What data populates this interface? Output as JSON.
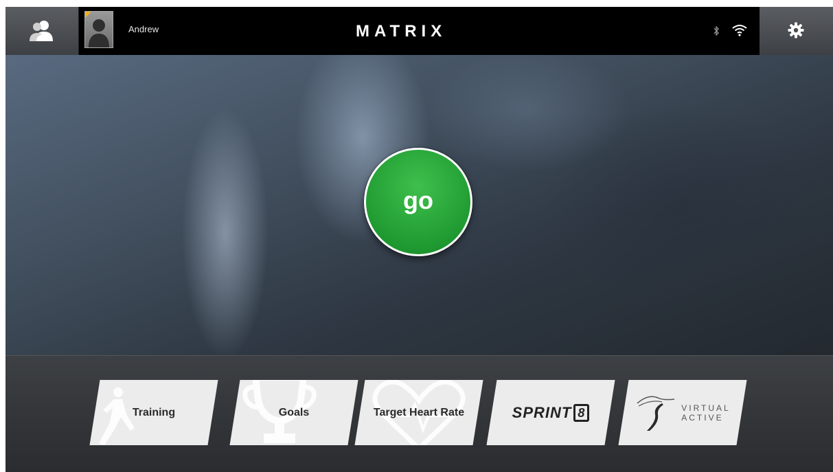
{
  "topbar": {
    "username": "Andrew",
    "logo": "MATRIX",
    "icons": {
      "users": "users-icon",
      "bluetooth": "bluetooth-icon",
      "wifi": "wifi-icon",
      "settings": "gear-icon"
    }
  },
  "hero": {
    "go_label": "go",
    "go_color": "#23a336"
  },
  "menu": {
    "tiles": [
      {
        "label": "Training",
        "icon": "runner-icon"
      },
      {
        "label": "Goals",
        "icon": "trophy-icon"
      },
      {
        "label": "Target Heart Rate",
        "icon": "heart-icon"
      },
      {
        "label": "SPRINT",
        "badge": "8",
        "icon": "sprint8-logo"
      },
      {
        "label_line1": "VIRTUAL",
        "label_line2": "ACTIVE",
        "icon": "virtual-active-logo"
      }
    ]
  }
}
